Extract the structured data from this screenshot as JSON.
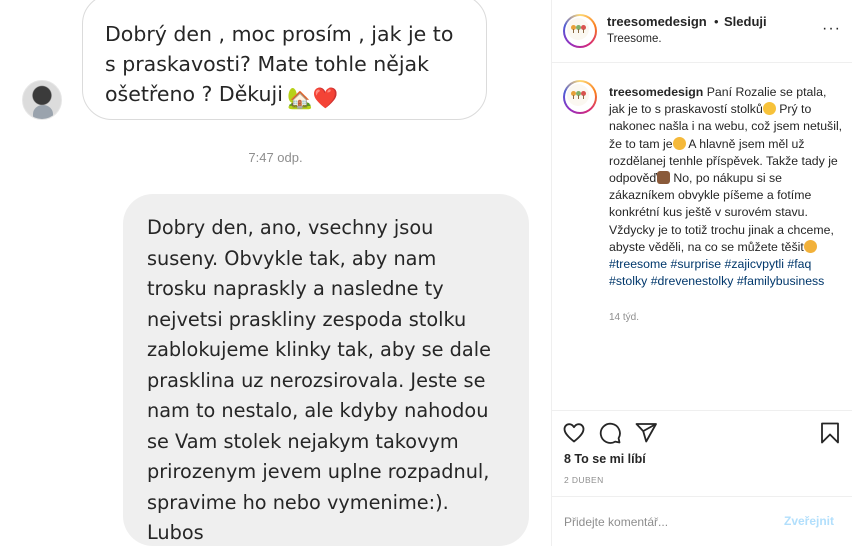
{
  "chat": {
    "incoming_text": "Dobrý den , moc prosím , jak je to s praskavosti? Mate tohle nějak ošetřeno ? Děkuji",
    "incoming_emojis": "🏡❤️",
    "timestamp": "7:47 odp.",
    "reply_text": "Dobry den, ano, vsechny jsou\nsuseny. Obvykle tak, aby nam\ntrosku napraskly a nasledne ty\nnejvetsi praskliny zespoda stolku\nzablokujeme klinky tak, aby se dale\nprasklina uz nerozsirovala. Jeste se\nnam to nestalo, ale kdyby nahodou\nse Vam stolek nejakym takovym\nprirozenym jevem uplne rozpadnul,\nspravime ho nebo vymenime:).\nLubos"
  },
  "post_header": {
    "username": "treesomedesign",
    "separator": "•",
    "follow_label": "Sleduji",
    "subtitle": "Treesome.",
    "more_icon": "more-horizontal-icon",
    "more_label": "···"
  },
  "caption": {
    "username": "treesomedesign",
    "seg1": "Paní Rozalie se ptala, jak je to s praskavostí stolků",
    "seg2": " Prý to nakonec našla i na webu, což jsem netušil, že to tam je",
    "seg3": " A hlavně jsem měl už rozdělanej tenhle příspěvek. Takže tady je odpověď",
    "seg4": " No, po nákupu si se zákazníkem obvykle píšeme a fotíme konkrétní kus ještě v surovém stavu. Vždycky je to totiž trochu jinak a chceme, abyste věděli, na co se můžete těšit",
    "hashtags": [
      "#treesome",
      "#surprise",
      "#zajicvpytli",
      "#faq",
      "#stolky",
      "#drevenestolky",
      "#familybusiness"
    ],
    "time_ago": "14 týd."
  },
  "actions": {
    "icons": [
      "heart-icon",
      "comment-icon",
      "share-icon",
      "bookmark-icon"
    ],
    "likes_text": "8 To se mi líbí",
    "date": "2 DUBEN"
  },
  "comment": {
    "placeholder": "Přidejte komentář...",
    "post_label": "Zveřejnit"
  },
  "colors": {
    "link_blue": "#00376b",
    "post_disabled": "#b2dffc",
    "bubble_gray": "#efefef",
    "border_gray": "#dbdbdb"
  }
}
